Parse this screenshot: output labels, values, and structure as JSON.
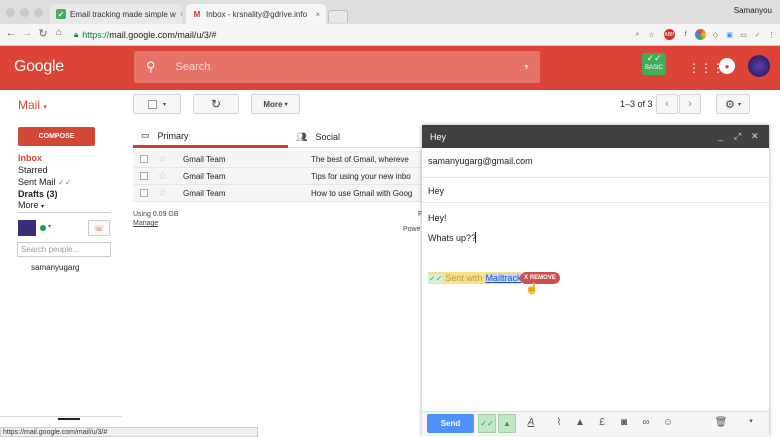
{
  "browser": {
    "tabs": [
      {
        "title": "Email tracking made simple w",
        "icon": "mailtrack-icon"
      },
      {
        "title": "Inbox - krsnality@gdrive.info",
        "icon": "gmail-icon"
      }
    ],
    "user_name": "Samanyou",
    "url_secure": "https://",
    "url_rest": "mail.google.com/mail/u/3/#",
    "status_url": "https://mail.google.com/mail/u/3/#"
  },
  "header": {
    "logo": "Google",
    "search_placeholder": "Search",
    "basic_badge": "BASIC",
    "brand_color": "#db4437"
  },
  "toolbar": {
    "mail_label": "Mail",
    "more_label": "More",
    "pager_text": "1–3 of 3"
  },
  "sidebar": {
    "compose_label": "COMPOSE",
    "items": [
      {
        "label": "Inbox"
      },
      {
        "label": "Starred"
      },
      {
        "label": "Sent Mail"
      },
      {
        "label": "Drafts (3)"
      },
      {
        "label": "More"
      }
    ],
    "search_people_placeholder": "Search people...",
    "contact_name": "samanyugarg"
  },
  "inbox": {
    "tabs": [
      {
        "label": "Primary"
      },
      {
        "label": "Social"
      }
    ],
    "rows": [
      {
        "sender": "Gmail Team",
        "subject": "The best of Gmail, whereve"
      },
      {
        "sender": "Gmail Team",
        "subject": "Tips for using your new inbo"
      },
      {
        "sender": "Gmail Team",
        "subject": "How to use Gmail with Goog"
      }
    ],
    "storage": "Using 0.09 GB",
    "manage": "Manage",
    "f_char": "F",
    "powered": "Powe"
  },
  "compose": {
    "title": "Hey",
    "to": "samanyugarg@gmail.com",
    "subject": "Hey",
    "body_line1": "Hey!",
    "body_line2": "Whats up??",
    "signature_prefix": "Sent with ",
    "signature_link": "Mailtrack",
    "remove_label": "X REMOVE",
    "send_label": "Send",
    "send_color": "#4d90fe"
  }
}
